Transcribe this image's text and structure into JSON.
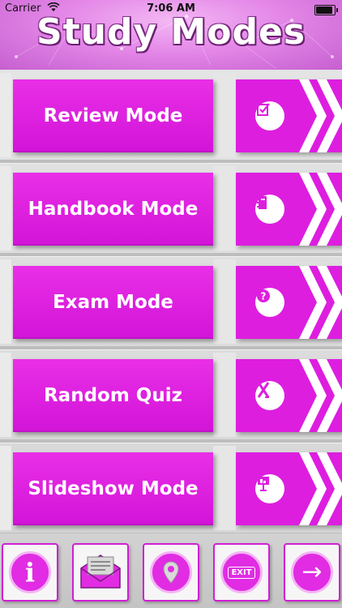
{
  "status_bar": {
    "carrier": "Carrier",
    "time": "7:06 AM"
  },
  "header": {
    "title": "Study Modes"
  },
  "modes": [
    {
      "label": "Review Mode",
      "icon": "checklist-icon"
    },
    {
      "label": "Handbook Mode",
      "icon": "notebook-icon"
    },
    {
      "label": "Exam Mode",
      "icon": "question-icon"
    },
    {
      "label": "Random Quiz",
      "icon": "shuffle-icon"
    },
    {
      "label": "Slideshow Mode",
      "icon": "presentation-icon"
    }
  ],
  "toolbar": {
    "info_glyph": "i",
    "exit_label": "EXIT",
    "next_glyph": "→"
  },
  "colors": {
    "accent": "#dd1edf",
    "header": "#e488e8"
  }
}
